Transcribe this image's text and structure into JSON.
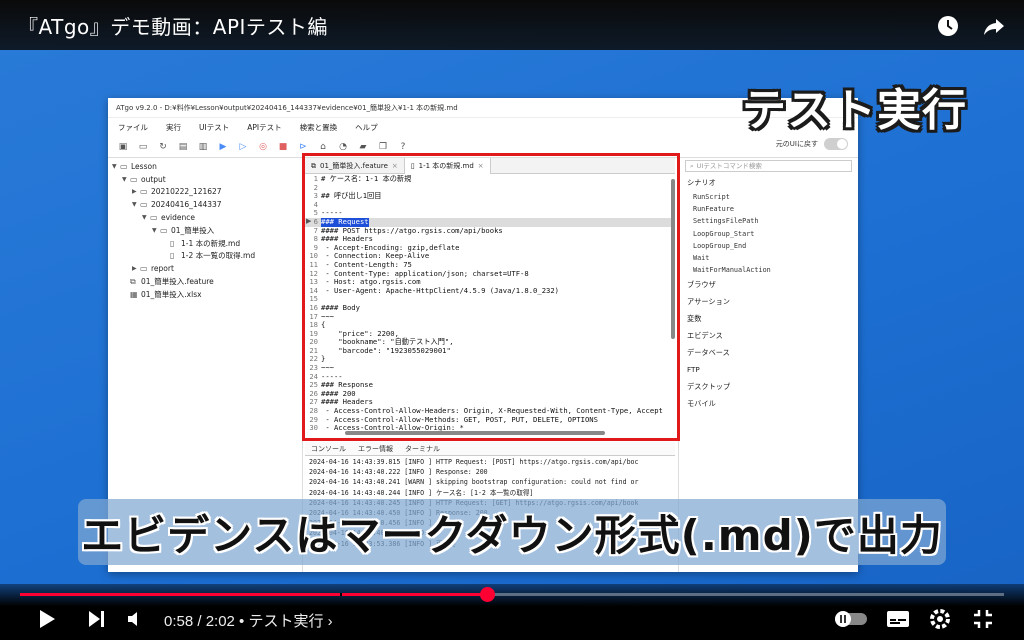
{
  "video": {
    "title": "『ATgo』デモ動画：APIテスト編",
    "overlay_title": "テスト実行",
    "caption": "エビデンスはマークダウン形式(.md)で出力"
  },
  "app": {
    "window_title": "ATgo v9.2.0 - D:¥料作¥Lesson¥output¥20240416_144337¥evidence¥01_簡単投入¥1-1 本の新規.md",
    "menu": [
      "ファイル",
      "実行",
      "UIテスト",
      "APIテスト",
      "検索と置換",
      "ヘルプ"
    ],
    "toggle_label": "元のUIに戻す",
    "tree": [
      {
        "label": "Lesson",
        "depth": 0,
        "arrow": "▼",
        "icon": "folder"
      },
      {
        "label": "output",
        "depth": 1,
        "arrow": "▼",
        "icon": "folder"
      },
      {
        "label": "20210222_121627",
        "depth": 2,
        "arrow": "▶",
        "icon": "folder"
      },
      {
        "label": "20240416_144337",
        "depth": 2,
        "arrow": "▼",
        "icon": "folder"
      },
      {
        "label": "evidence",
        "depth": 3,
        "arrow": "▼",
        "icon": "folder"
      },
      {
        "label": "01_簡単投入",
        "depth": 4,
        "arrow": "▼",
        "icon": "folder"
      },
      {
        "label": "1-1 本の新規.md",
        "depth": 5,
        "arrow": "",
        "icon": "file"
      },
      {
        "label": "1-2 本一覧の取得.md",
        "depth": 5,
        "arrow": "",
        "icon": "file"
      },
      {
        "label": "report",
        "depth": 2,
        "arrow": "▶",
        "icon": "folder"
      },
      {
        "label": "01_簡単投入.feature",
        "depth": 1,
        "arrow": "",
        "icon": "feature"
      },
      {
        "label": "01_簡単投入.xlsx",
        "depth": 1,
        "arrow": "",
        "icon": "xlsx"
      }
    ],
    "editor_tabs": [
      "01_簡単投入.feature",
      "1-1 本の新規.md"
    ],
    "editor_lines": [
      "# ケース名：1-1 本の新規",
      "",
      "## 呼び出し1回目",
      "",
      "-----",
      "### Request",
      "#### POST https://atgo.rgsis.com/api/books",
      "#### Headers",
      " - Accept-Encoding: gzip,deflate",
      " - Connection: Keep-Alive",
      " - Content-Length: 75",
      " - Content-Type: application/json; charset=UTF-8",
      " - Host: atgo.rgsis.com",
      " - User-Agent: Apache-HttpClient/4.5.9 (Java/1.8.0_232)",
      "",
      "#### Body",
      "~~~",
      "{",
      "    \"price\": 2200,",
      "    \"bookname\": \"自動テスト入門\",",
      "    \"barcode\": \"1923055029001\"",
      "}",
      "~~~",
      "-----",
      "### Response",
      "#### 200",
      "#### Headers",
      " - Access-Control-Allow-Headers: Origin, X-Requested-With, Content-Type, Accept",
      " - Access-Control-Allow-Methods: GET, POST, PUT, DELETE, OPTIONS",
      " - Access-Control-Allow-Origin: *"
    ],
    "highlight_line": 6,
    "console_tabs": [
      "コンソール",
      "エラー情報",
      "ターミナル"
    ],
    "console_lines": [
      "2024-04-16 14:43:39.815 [INFO ] HTTP Request: [POST] https://atgo.rgsis.com/api/boc",
      "2024-04-16 14:43:40.222 [INFO ] Response: 200",
      "2024-04-16 14:43:40.241 [WARN ] skipping bootstrap configuration: could not find or",
      "2024-04-16 14:43:40.244 [INFO ] ケース名: [1-2 本一覧の取得]",
      "2024-04-16 14:43:40.245 [INFO ] HTTP Request: [GET] https://atgo.rgsis.com/api/book",
      "2024-04-16 14:43:40.450 [INFO ] Response: 200",
      "2024-04-16 14:43:40.456 [INFO ]",
      "2024-04-16 14:43:40.459 [INFO ]",
      "2024-04-16 14:43:53.386 [INFO ] 再生終"
    ],
    "right_search_placeholder": "UIテストコマンド検索",
    "right_categories": [
      {
        "label": "シナリオ",
        "items": [
          "RunScript",
          "RunFeature",
          "SettingsFilePath",
          "LoopGroup_Start",
          "LoopGroup_End",
          "Wait",
          "WaitForManualAction"
        ]
      },
      {
        "label": "ブラウザ",
        "items": []
      },
      {
        "label": "アサーション",
        "items": []
      },
      {
        "label": "変数",
        "items": []
      },
      {
        "label": "エビデンス",
        "items": []
      },
      {
        "label": "データベース",
        "items": []
      },
      {
        "label": "FTP",
        "items": []
      },
      {
        "label": "デスクトップ",
        "items": []
      },
      {
        "label": "モバイル",
        "items": []
      }
    ]
  },
  "player": {
    "time": "0:58 / 2:02 • テスト実行 ›",
    "progress": 0.475,
    "chapter_marks": [
      0.325
    ],
    "accent": "#ff0033",
    "icons": [
      "play-icon",
      "next-icon",
      "volume-icon",
      "autoplay-toggle-icon",
      "subtitles-icon",
      "settings-icon",
      "exit-fullscreen-icon",
      "watch-later-icon",
      "share-icon"
    ]
  }
}
